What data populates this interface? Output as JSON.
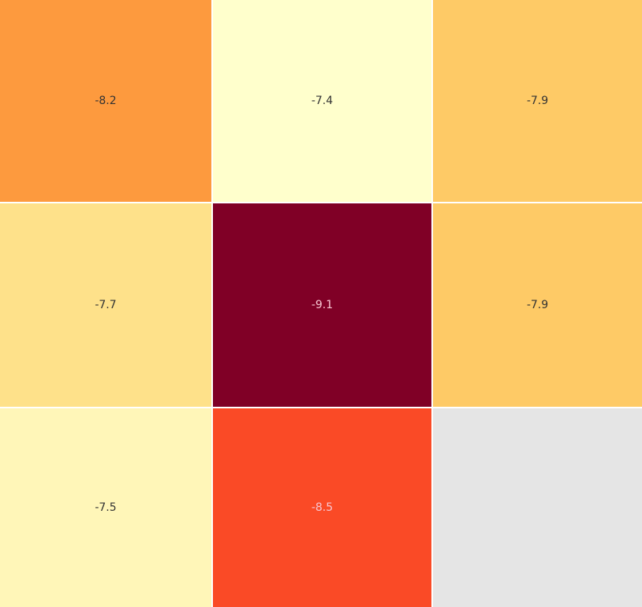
{
  "chart_data": {
    "type": "heatmap",
    "rows": 3,
    "cols": 3,
    "values": [
      [
        -8.2,
        -7.4,
        -7.9
      ],
      [
        -7.7,
        -9.1,
        -7.9
      ],
      [
        -7.5,
        -8.5,
        null
      ]
    ],
    "labels": [
      [
        "-8.2",
        "-7.4",
        "-7.9"
      ],
      [
        "-7.7",
        "-9.1",
        "-7.9"
      ],
      [
        "-7.5",
        "-8.5",
        ""
      ]
    ],
    "colors": [
      [
        "#fd9a3e",
        "#ffffcc",
        "#feca66"
      ],
      [
        "#fee18a",
        "#800026",
        "#feca66"
      ],
      [
        "#fff6b8",
        "#fa4a26",
        "#e5e5e5"
      ]
    ],
    "colormap": "YlOrRd (reversed: lower value = darker)",
    "missing_color": "#e5e5e5",
    "dark_text_color": "#333333",
    "light_text_color": "#f7c6d2"
  }
}
